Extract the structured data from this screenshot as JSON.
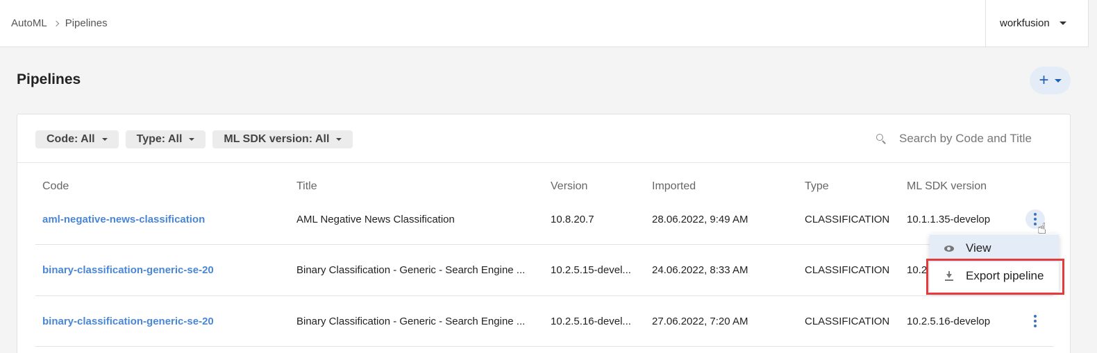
{
  "breadcrumb": {
    "root": "AutoML",
    "current": "Pipelines"
  },
  "user": {
    "name": "workfusion"
  },
  "page": {
    "title": "Pipelines",
    "add_label": "+"
  },
  "filters": {
    "code": "Code: All",
    "type": "Type: All",
    "sdk": "ML SDK version: All"
  },
  "search": {
    "placeholder": "Search by Code and Title"
  },
  "table": {
    "headers": [
      "Code",
      "Title",
      "Version",
      "Imported",
      "Type",
      "ML SDK version"
    ],
    "rows": [
      {
        "code": "aml-negative-news-classification",
        "title": "AML Negative News Classification",
        "version": "10.8.20.7",
        "imported": "28.06.2022, 9:49 AM",
        "type": "CLASSIFICATION",
        "sdk": "10.1.1.35-develop"
      },
      {
        "code": "binary-classification-generic-se-20",
        "title": "Binary Classification - Generic - Search Engine ...",
        "version": "10.2.5.15-devel...",
        "imported": "24.06.2022, 8:33 AM",
        "type": "CLASSIFICATION",
        "sdk": "10.2"
      },
      {
        "code": "binary-classification-generic-se-20",
        "title": "Binary Classification - Generic - Search Engine ...",
        "version": "10.2.5.16-devel...",
        "imported": "27.06.2022, 7:20 AM",
        "type": "CLASSIFICATION",
        "sdk": "10.2.5.16-develop"
      }
    ]
  },
  "menu": {
    "items": [
      {
        "label": "View",
        "icon": "eye-icon"
      },
      {
        "label": "Export pipeline",
        "icon": "download-icon"
      }
    ]
  },
  "colors": {
    "accent": "#1f5fb8",
    "link": "#4a86d6",
    "highlight": "#e63a3a"
  }
}
